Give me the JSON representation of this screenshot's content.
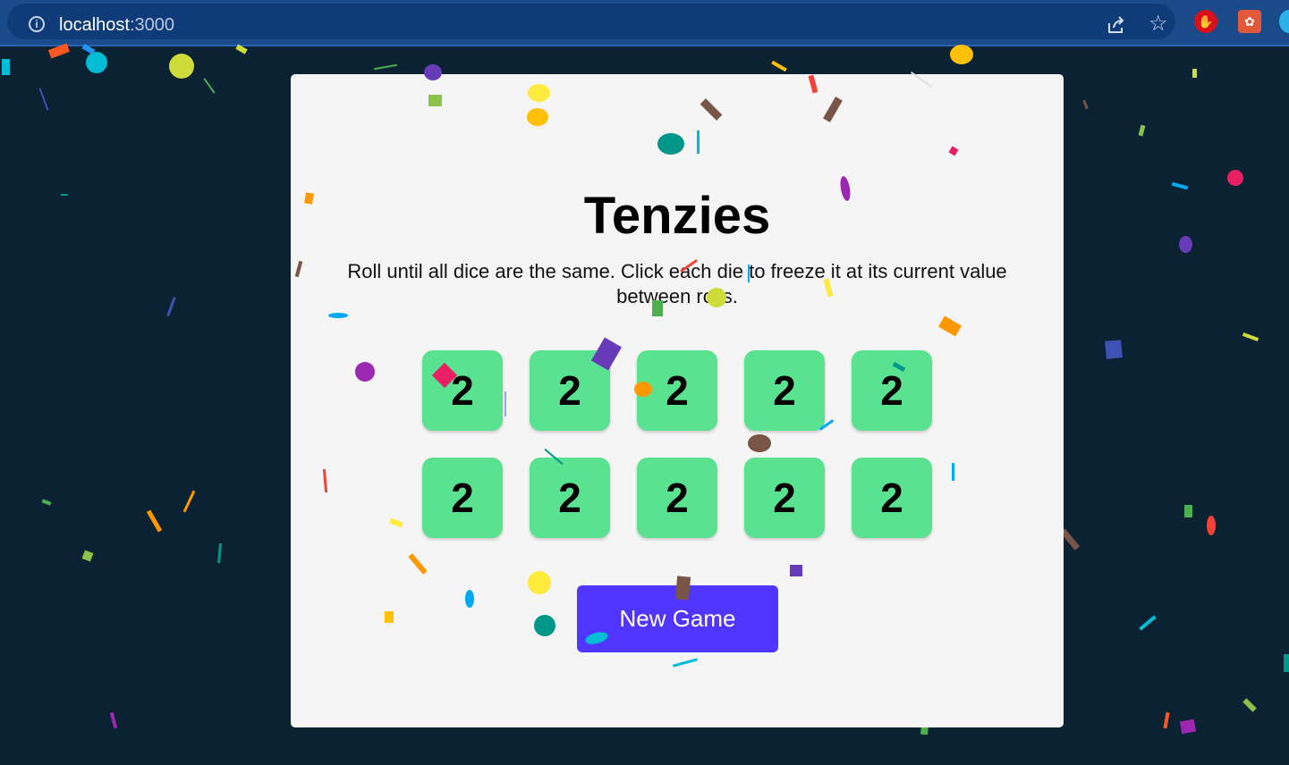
{
  "browser": {
    "url_host": "localhost",
    "url_port": ":3000",
    "icons": [
      "info-icon",
      "share-icon",
      "star-icon",
      "extension-stop-icon",
      "extension-puzzle-icon",
      "extension-blue-icon"
    ]
  },
  "app": {
    "title": "Tenzies",
    "instructions": "Roll until all dice are the same. Click each die to freeze it at its current value between rolls.",
    "dice": [
      {
        "value": "2",
        "held": true
      },
      {
        "value": "2",
        "held": true
      },
      {
        "value": "2",
        "held": true
      },
      {
        "value": "2",
        "held": true
      },
      {
        "value": "2",
        "held": true
      },
      {
        "value": "2",
        "held": true
      },
      {
        "value": "2",
        "held": true
      },
      {
        "value": "2",
        "held": true
      },
      {
        "value": "2",
        "held": true
      },
      {
        "value": "2",
        "held": true
      }
    ],
    "button_label": "New Game"
  },
  "colors": {
    "page_background": "#0b2233",
    "card_background": "#f5f5f5",
    "die_held": "#59e391",
    "button": "#5035ff",
    "browser_bar": "#1a4a8a"
  }
}
